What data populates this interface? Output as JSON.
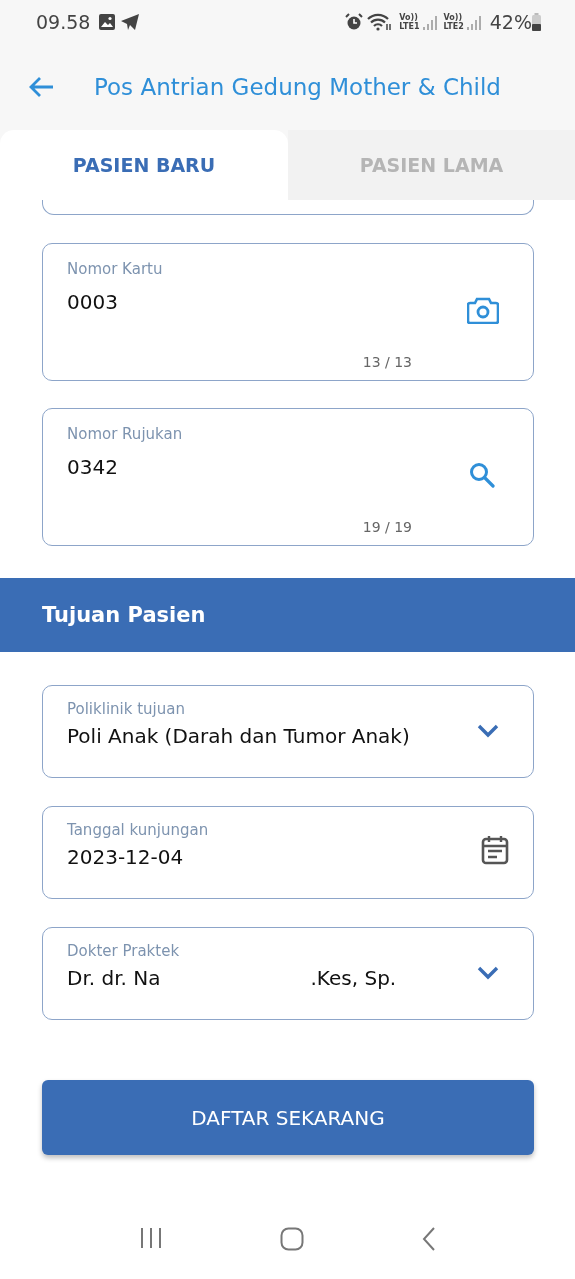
{
  "status_bar": {
    "time": "09.58",
    "sim_labels": [
      {
        "top": "Vo))",
        "bottom": "LTE1"
      },
      {
        "top": "Vo))",
        "bottom": "LTE2"
      }
    ],
    "battery": "42%"
  },
  "header": {
    "title": "Pos Antrian Gedung Mother & Child"
  },
  "tabs": [
    {
      "label": "PASIEN BARU",
      "selected": true
    },
    {
      "label": "PASIEN LAMA",
      "selected": false
    }
  ],
  "patient_fields": [
    {
      "label": "Nomor Kartu",
      "value": "0003",
      "counter": "13 / 13",
      "kind": "camera"
    },
    {
      "label": "Nomor Rujukan",
      "value": "0342",
      "counter": "19 / 19",
      "kind": "search"
    }
  ],
  "section": {
    "title": "Tujuan Pasien"
  },
  "destination_fields": [
    {
      "label": "Poliklinik tujuan",
      "value": "Poli Anak (Darah dan Tumor Anak)",
      "kind": "dropdown"
    },
    {
      "label": "Tanggal kunjungan",
      "value": "2023-12-04",
      "kind": "date"
    },
    {
      "label": "Dokter Praktek",
      "value": "Dr. dr. Na",
      "value_end": ".Kes, Sp.",
      "kind": "dropdown"
    }
  ],
  "submit_button": {
    "label": "DAFTAR SEKARANG"
  }
}
